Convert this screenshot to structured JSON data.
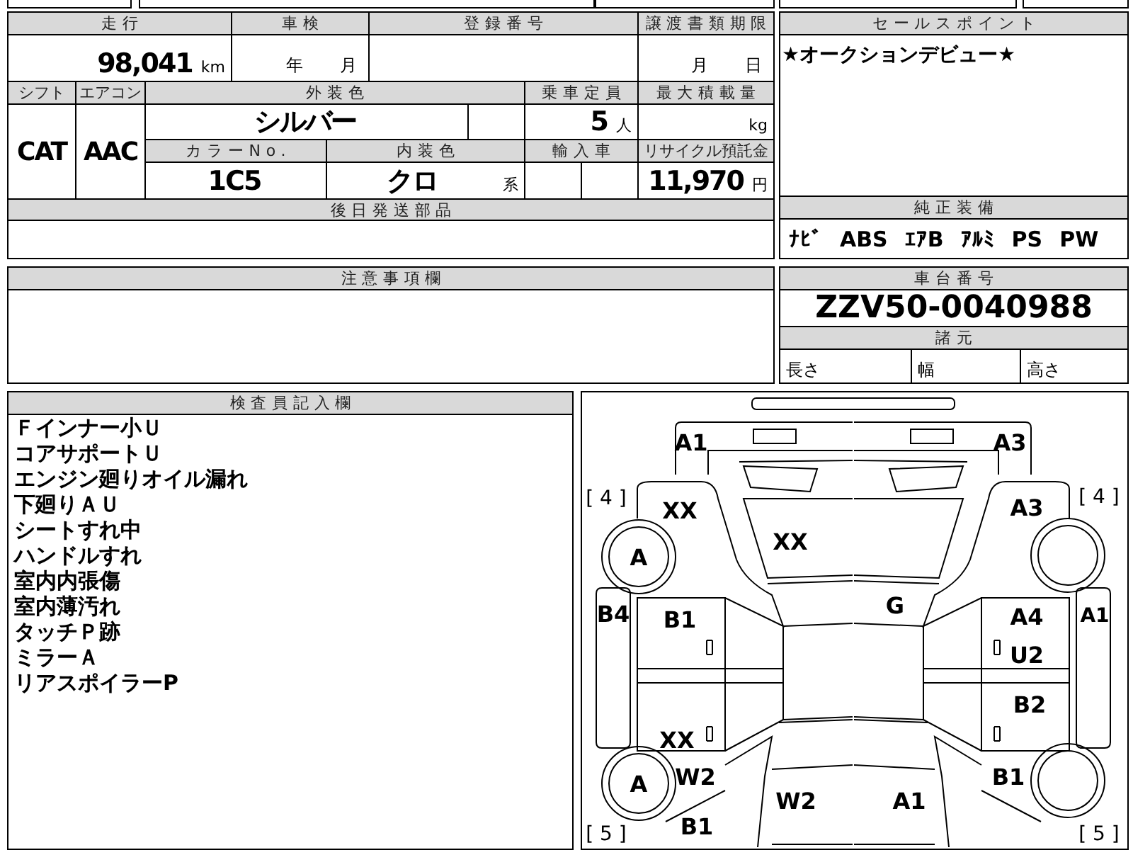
{
  "info_table": {
    "cells": [
      {
        "kind": "header",
        "text": "走行"
      },
      {
        "kind": "header",
        "text": "車検"
      },
      {
        "kind": "header",
        "text": "登録番号"
      },
      {
        "kind": "header",
        "text": "譲渡書類期限"
      },
      {
        "kind": "value",
        "text": "98,041",
        "unit": "km"
      },
      {
        "kind": "date",
        "parts": [
          "年",
          "月"
        ]
      },
      {
        "kind": "blank"
      },
      {
        "kind": "date",
        "parts": [
          "月",
          "日"
        ]
      },
      {
        "kind": "header",
        "text": "シフト"
      },
      {
        "kind": "header",
        "text": "エアコン"
      },
      {
        "kind": "header",
        "text": "外装色"
      },
      {
        "kind": "header",
        "text": "乗車定員"
      },
      {
        "kind": "header",
        "text": "最大積載量"
      },
      {
        "kind": "big",
        "text": "CAT"
      },
      {
        "kind": "big",
        "text": "AAC"
      },
      {
        "kind": "value",
        "text": "シルバー"
      },
      {
        "kind": "blank"
      },
      {
        "kind": "value",
        "text": "5",
        "unit": "人"
      },
      {
        "kind": "value",
        "unit": "kg"
      },
      {
        "kind": "header",
        "text": "カラーNo."
      },
      {
        "kind": "header",
        "text": "内装色"
      },
      {
        "kind": "header",
        "text": "輸入車"
      },
      {
        "kind": "header",
        "text": "リサイクル預託金"
      },
      {
        "kind": "value",
        "text": "1C5"
      },
      {
        "kind": "value",
        "text": "クロ",
        "unit": "系"
      },
      {
        "kind": "blank"
      },
      {
        "kind": "blank"
      },
      {
        "kind": "value",
        "text": "11,970",
        "unit": "円"
      },
      {
        "kind": "header",
        "text": "後日発送部品"
      },
      {
        "kind": "blank"
      }
    ]
  },
  "sales_point": {
    "title": "セールスポイント",
    "text": "★オークションデビュー★"
  },
  "standard_equipment": {
    "title": "純正装備",
    "items": [
      "ﾅﾋﾞ",
      "ABS",
      "ｴｱB",
      "ｱﾙﾐ",
      "PS",
      "PW"
    ]
  },
  "notes": {
    "title": "注意事項欄"
  },
  "chassis": {
    "title": "車台番号",
    "number": "ZZV50-0040988",
    "spec_title": "諸元",
    "specs": [
      "長さ",
      "幅",
      "高さ"
    ]
  },
  "inspector_notes": {
    "title": "検査員記入欄",
    "lines": [
      "Ｆインナー小Ｕ",
      "コアサポートＵ",
      "エンジン廻りオイル漏れ",
      "下廻りＡＵ",
      "シートすれ中",
      "ハンドルすれ",
      "室内内張傷",
      "室内薄汚れ",
      "タッチＰ跡",
      "ミラーＡ",
      "リアスポイラーP"
    ]
  },
  "diagram": {
    "marks": [
      {
        "kind": "code",
        "text": "A1"
      },
      {
        "kind": "code",
        "text": "A3"
      },
      {
        "kind": "bracket",
        "text": "[ 4 ]"
      },
      {
        "kind": "code",
        "text": "XX"
      },
      {
        "kind": "code",
        "text": "XX"
      },
      {
        "kind": "bracket",
        "text": "[ 4 ]"
      },
      {
        "kind": "code",
        "text": "A3"
      },
      {
        "kind": "code",
        "text": "A"
      },
      {
        "kind": "code",
        "text": "B4"
      },
      {
        "kind": "code",
        "text": "B1"
      },
      {
        "kind": "code",
        "text": "G"
      },
      {
        "kind": "code",
        "text": "A4"
      },
      {
        "kind": "code",
        "text": "A1"
      },
      {
        "kind": "code",
        "text": "U2"
      },
      {
        "kind": "code",
        "text": "B2"
      },
      {
        "kind": "code",
        "text": "XX"
      },
      {
        "kind": "code",
        "text": "A"
      },
      {
        "kind": "code",
        "text": "W2"
      },
      {
        "kind": "code",
        "text": "B1"
      },
      {
        "kind": "code",
        "text": "W2"
      },
      {
        "kind": "code",
        "text": "A1"
      },
      {
        "kind": "code",
        "text": "B1"
      },
      {
        "kind": "bracket",
        "text": "[ 5 ]"
      },
      {
        "kind": "bracket",
        "text": "[ 5 ]"
      }
    ]
  }
}
